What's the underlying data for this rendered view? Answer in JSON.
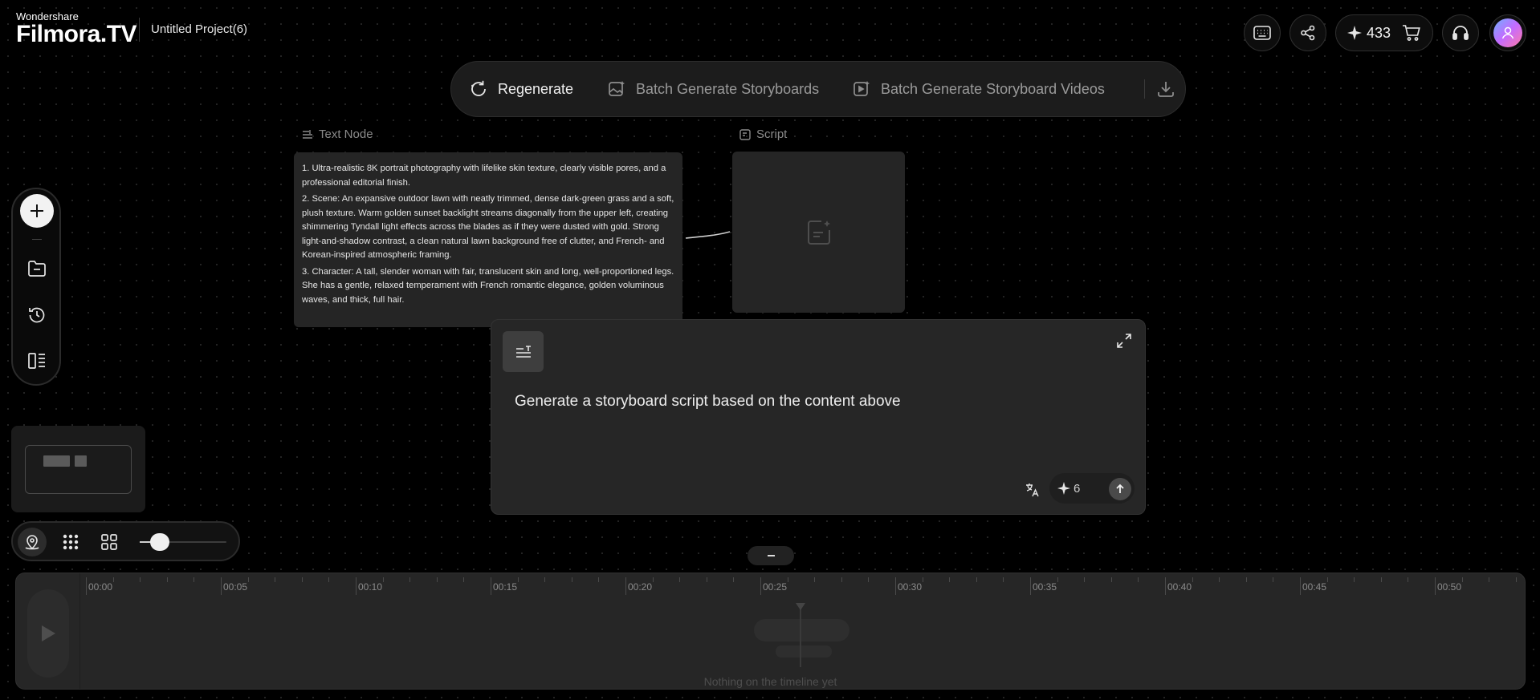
{
  "app": {
    "brand": "Wondershare",
    "product": "Filmora.TV",
    "project_title": "Untitled Project(6)"
  },
  "header": {
    "credits": "433"
  },
  "toolbar": {
    "regenerate": "Regenerate",
    "batch_storyboards": "Batch Generate Storyboards",
    "batch_videos": "Batch Generate Storyboard Videos"
  },
  "text_node": {
    "label": "Text Node",
    "paragraphs": [
      "1. Ultra-realistic 8K portrait photography with lifelike skin texture, clearly visible pores, and a professional editorial finish.",
      "2. Scene: An expansive outdoor lawn with neatly trimmed, dense dark-green grass and a soft, plush texture. Warm golden sunset backlight streams diagonally from the upper left, creating shimmering Tyndall light effects across the blades as if they were dusted with gold. Strong light-and-shadow contrast, a clean natural lawn background free of clutter, and French- and Korean-inspired atmospheric framing.",
      "3. Character: A tall, slender woman with fair, translucent skin and long, well-proportioned legs. She has a gentle, relaxed temperament with French romantic elegance, golden voluminous waves, and thick, full hair."
    ]
  },
  "script_node": {
    "label": "Script"
  },
  "prompt": {
    "text": "Generate a storyboard script based on the content above",
    "cost": "6"
  },
  "timeline": {
    "ticks": [
      "00:00",
      "00:05",
      "00:10",
      "00:15",
      "00:20",
      "00:25",
      "00:30",
      "00:35",
      "00:40",
      "00:45",
      "00:50"
    ],
    "empty_message": "Nothing on the timeline yet"
  },
  "zoom": {
    "level": 0.2
  },
  "colors": {
    "background": "#000000",
    "panel": "#262626",
    "text": "#ececec",
    "muted": "#8a8a8a"
  }
}
